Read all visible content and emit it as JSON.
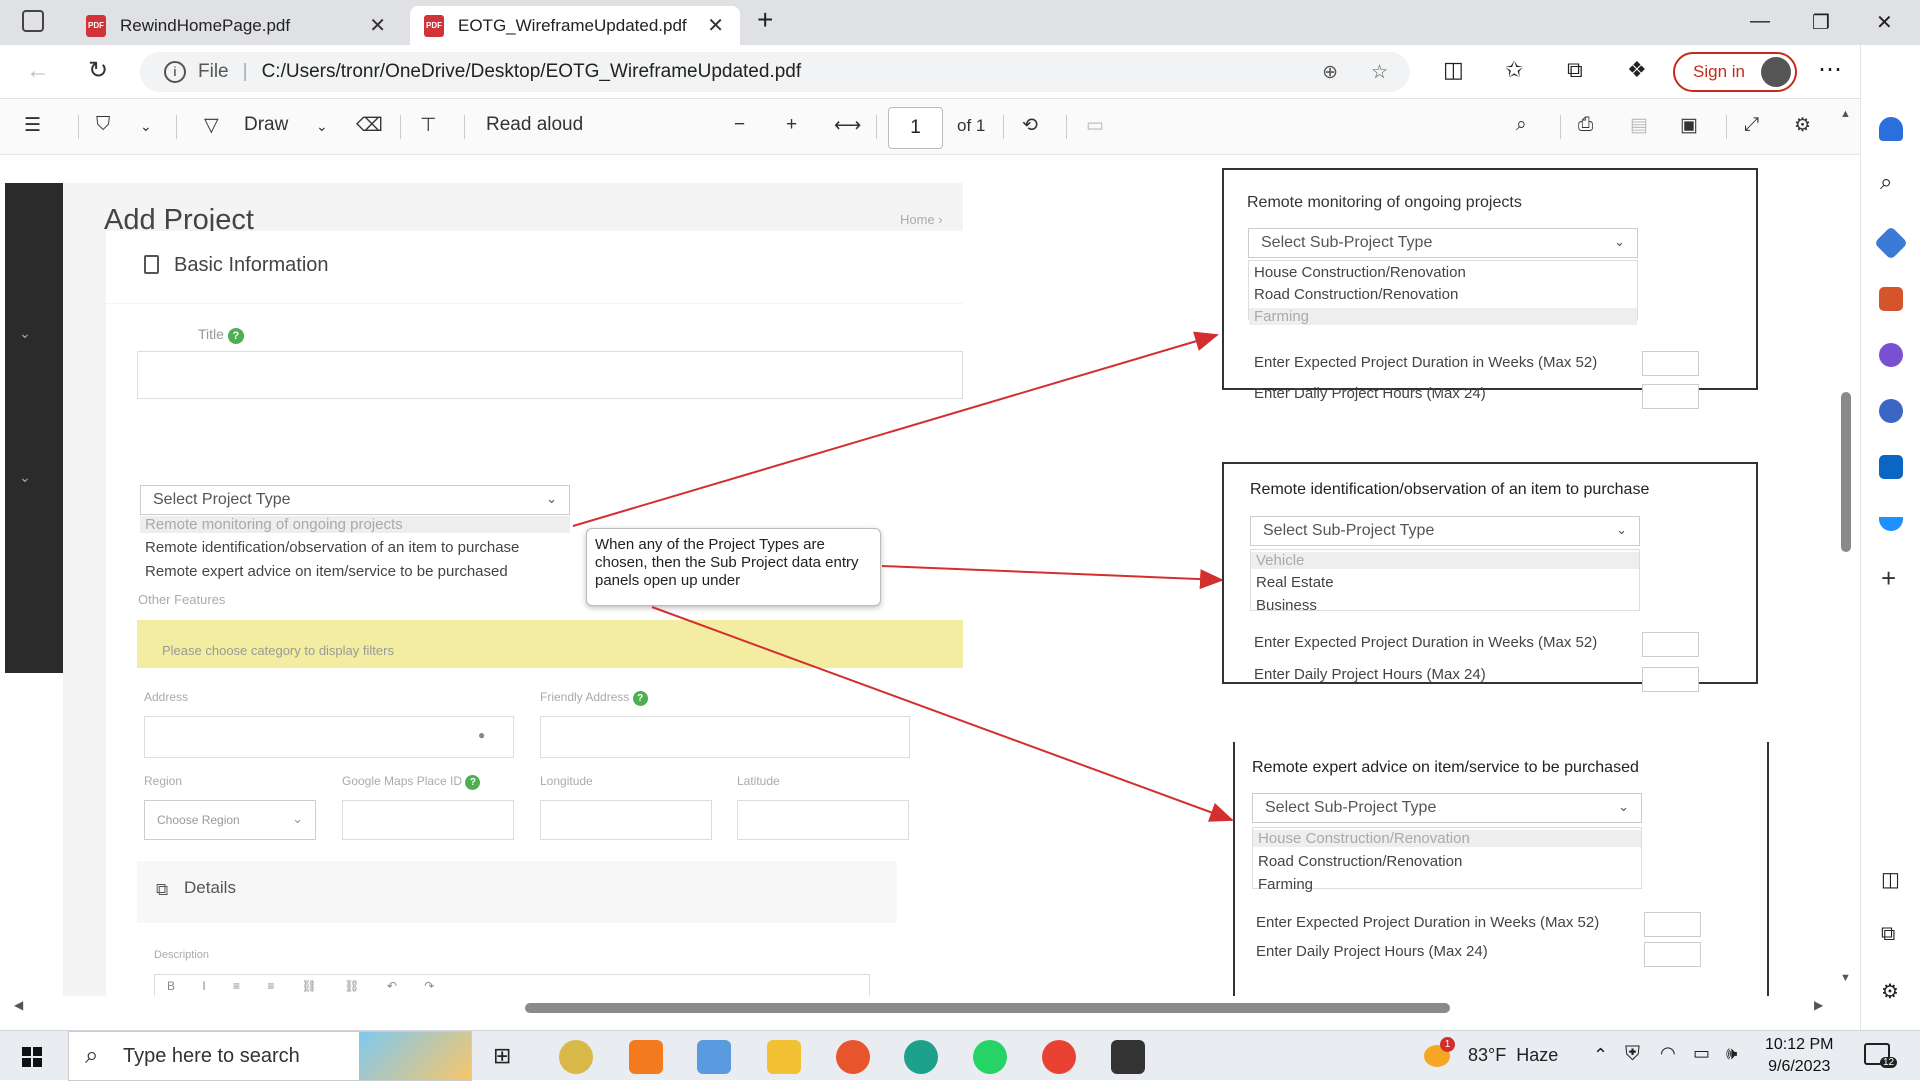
{
  "browser": {
    "tabs": [
      {
        "label": "RewindHomePage.pdf"
      },
      {
        "label": "EOTG_WireframeUpdated.pdf"
      }
    ],
    "address": {
      "scheme_label": "File",
      "url": "C:/Users/tronr/OneDrive/Desktop/EOTG_WireframeUpdated.pdf"
    },
    "signin_label": "Sign in"
  },
  "pdf_toolbar": {
    "draw_label": "Draw",
    "read_aloud_label": "Read aloud",
    "page_number": "1",
    "page_total": "of 1"
  },
  "form": {
    "title": "Add Project",
    "breadcrumb": "Home",
    "section_basic": "Basic Information",
    "title_label": "Title",
    "project_type_placeholder": "Select Project Type",
    "project_types": [
      "Remote monitoring of ongoing projects",
      "Remote identification/observation of an item to purchase",
      "Remote expert advice on item/service to be purchased"
    ],
    "other_features": "Other Features",
    "category_notice": "Please choose category to display filters",
    "address_label": "Address",
    "friendly_address_label": "Friendly Address",
    "region_label": "Region",
    "google_place_label": "Google Maps Place ID",
    "longitude_label": "Longitude",
    "latitude_label": "Latitude",
    "region_placeholder": "Choose Region",
    "details_label": "Details",
    "description_label": "Description"
  },
  "callout": "When any of the Project Types are chosen, then the Sub Project data entry panels open up under",
  "panels": [
    {
      "title": "Remote monitoring of ongoing projects",
      "sub_placeholder": "Select Sub-Project Type",
      "options": [
        "House Construction/Renovation",
        "Road Construction/Renovation",
        "Farming"
      ],
      "duration_label": "Enter Expected Project Duration in Weeks (Max 52)",
      "hours_label": "Enter Daily Project Hours (Max 24)"
    },
    {
      "title": "Remote identification/observation of an item to purchase",
      "sub_placeholder": "Select Sub-Project Type",
      "options": [
        "Vehicle",
        "Real Estate",
        "Business"
      ],
      "duration_label": "Enter Expected Project Duration in Weeks (Max 52)",
      "hours_label": "Enter Daily Project Hours (Max 24)"
    },
    {
      "title": "Remote expert advice on item/service to be purchased",
      "sub_placeholder": "Select Sub-Project Type",
      "options": [
        "House Construction/Renovation",
        "Road Construction/Renovation",
        "Farming"
      ],
      "duration_label": "Enter Expected Project Duration in Weeks (Max 52)",
      "hours_label": "Enter Daily Project Hours (Max 24)"
    }
  ],
  "taskbar": {
    "search_placeholder": "Type here to search",
    "weather": "83°F  Haze",
    "weather_badge": "1",
    "time": "10:12 PM",
    "date": "9/6/2023",
    "notif_count": "12"
  },
  "colors": {
    "arrow": "#d32f2f",
    "accent": "#0b57d0",
    "signin": "#c42b1c",
    "notice": "#f3eda2"
  }
}
